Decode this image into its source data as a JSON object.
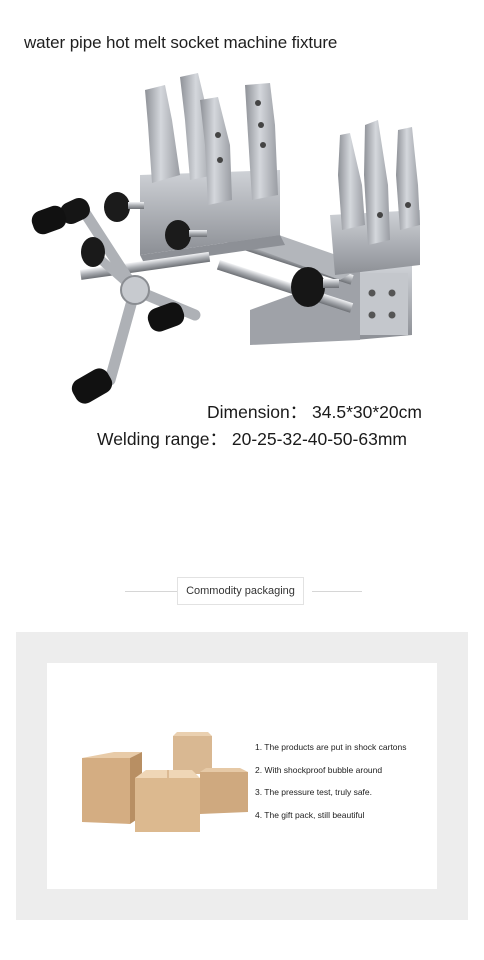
{
  "header": {
    "title": "water pipe hot melt socket machine fixture"
  },
  "specs": {
    "dimension": "Dimension： 34.5*30*20cm",
    "welding_range": "Welding range： 20-25-32-40-50-63mm"
  },
  "packaging": {
    "section_title": "Commodity packaging",
    "items": [
      "1. The products are put in shock cartons",
      "2. With shockproof bubble around",
      "3. The pressure test, truly safe.",
      "4. The gift pack, still beautiful"
    ]
  },
  "colors": {
    "metal": "#b9bcc2",
    "knob": "#1b1b1b",
    "cardboard": "#d7b48c",
    "panel_bg": "#ededed"
  }
}
